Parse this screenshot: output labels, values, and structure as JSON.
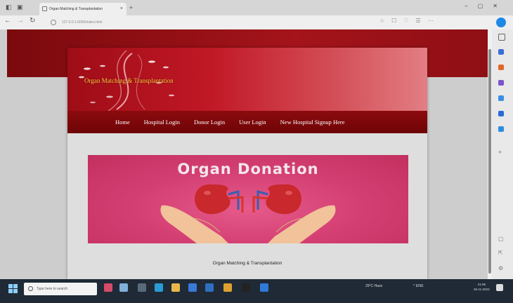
{
  "browser": {
    "tab_title": "Organ Matching & Transplantation",
    "tab_close": "×",
    "new_tab": "+",
    "url": "127.0.0.1:5000/index.html"
  },
  "site": {
    "title": "Organ Matching & Transplantation",
    "nav": [
      "Home",
      "Hospital Login",
      "Donor Login",
      "User Login",
      "New Hospital Signup Here"
    ],
    "hero_title": "Organ Donation",
    "footer": "Organ Matching & Transplantation"
  },
  "taskbar": {
    "search_placeholder": "Type here to search",
    "weather": "29°C Haze",
    "tray": "^  ENG",
    "time": "21:06",
    "date": "26-11-2023"
  },
  "colors": {
    "banner_red": "#c11826",
    "nav_dark_red": "#6e0406",
    "hero_pink": "#d43f73",
    "title_gold": "#f2d046"
  },
  "icons": {
    "back": "back-arrow-icon",
    "refresh": "refresh-icon",
    "kidney": "kidney-icon",
    "hands": "hands-icon"
  }
}
